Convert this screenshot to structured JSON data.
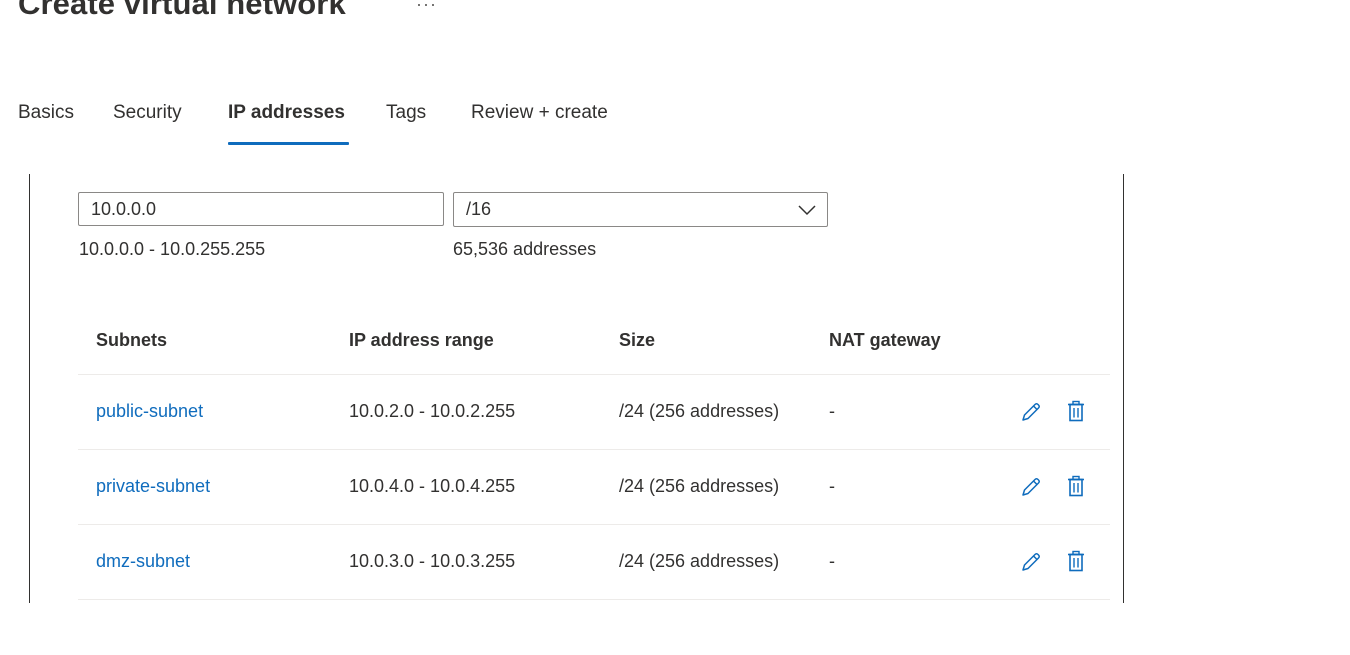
{
  "page": {
    "title": "Create virtual network",
    "more_label": "···"
  },
  "tabs": [
    {
      "label": "Basics"
    },
    {
      "label": "Security"
    },
    {
      "label": "IP addresses",
      "active": true
    },
    {
      "label": "Tags"
    },
    {
      "label": "Review + create"
    }
  ],
  "address_space": {
    "start_ip": "10.0.0.0",
    "prefix": "/16",
    "range": "10.0.0.0 - 10.0.255.255",
    "count": "65,536 addresses"
  },
  "subnets_table": {
    "headers": {
      "subnets": "Subnets",
      "ip_range": "IP address range",
      "size": "Size",
      "nat_gateway": "NAT gateway"
    },
    "rows": [
      {
        "name": "public-subnet",
        "range": "10.0.2.0 - 10.0.2.255",
        "size": "/24 (256 addresses)",
        "nat": "-"
      },
      {
        "name": "private-subnet",
        "range": "10.0.4.0 - 10.0.4.255",
        "size": "/24 (256 addresses)",
        "nat": "-"
      },
      {
        "name": "dmz-subnet",
        "range": "10.0.3.0 - 10.0.3.255",
        "size": "/24 (256 addresses)",
        "nat": "-"
      }
    ]
  },
  "colors": {
    "accent": "#0f6cbd",
    "text": "#323130",
    "border": "#8a8886",
    "divider": "#edebe9"
  },
  "icons": {
    "edit": "pencil-icon",
    "delete": "trash-icon",
    "dropdown": "chevron-down-icon"
  }
}
